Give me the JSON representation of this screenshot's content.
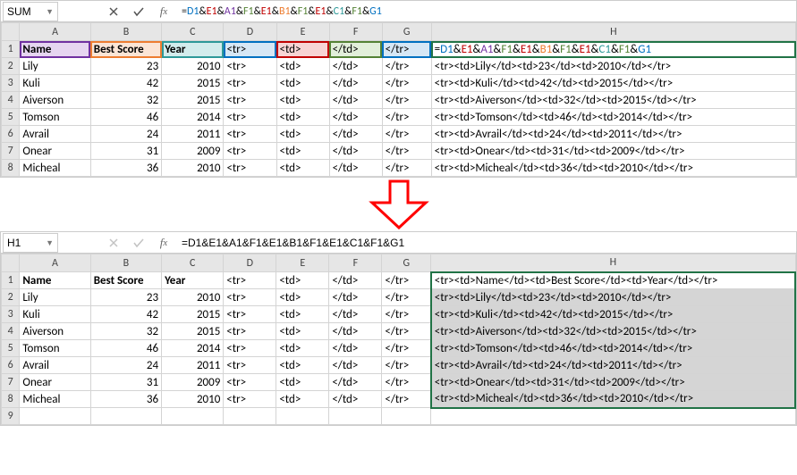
{
  "top": {
    "nameBox": "SUM",
    "formula_raw": "=D1&E1&A1&F1&E1&B1&F1&E1&C1&F1&G1",
    "formula_tokens": [
      {
        "t": "=",
        "cls": ""
      },
      {
        "t": "D1",
        "cls": "c-blue"
      },
      {
        "t": "&",
        "cls": ""
      },
      {
        "t": "E1",
        "cls": "c-red"
      },
      {
        "t": "&",
        "cls": ""
      },
      {
        "t": "A1",
        "cls": "c-purple"
      },
      {
        "t": "&",
        "cls": ""
      },
      {
        "t": "F1",
        "cls": "c-green2"
      },
      {
        "t": "&",
        "cls": ""
      },
      {
        "t": "E1",
        "cls": "c-red"
      },
      {
        "t": "&",
        "cls": ""
      },
      {
        "t": "B1",
        "cls": "c-orange"
      },
      {
        "t": "&",
        "cls": ""
      },
      {
        "t": "F1",
        "cls": "c-green2"
      },
      {
        "t": "&",
        "cls": ""
      },
      {
        "t": "E1",
        "cls": "c-red"
      },
      {
        "t": "&",
        "cls": ""
      },
      {
        "t": "C1",
        "cls": "c-teal"
      },
      {
        "t": "&",
        "cls": ""
      },
      {
        "t": "F1",
        "cls": "c-green2"
      },
      {
        "t": "&",
        "cls": ""
      },
      {
        "t": "G1",
        "cls": "c-blue"
      }
    ],
    "columns": [
      "A",
      "B",
      "C",
      "D",
      "E",
      "F",
      "G",
      "H"
    ],
    "rows": [
      {
        "n": "1",
        "A": "Name",
        "B": "Best Score",
        "C": "Year",
        "D": "<tr>",
        "E": "<td>",
        "F": "</td>",
        "G": "</tr>",
        "H": ""
      },
      {
        "n": "2",
        "A": "Lily",
        "B": "23",
        "C": "2010",
        "D": "<tr>",
        "E": "<td>",
        "F": "</td>",
        "G": "</tr>",
        "H": "<tr><td>Lily</td><td>23</td><td>2010</td></tr>"
      },
      {
        "n": "3",
        "A": "Kuli",
        "B": "42",
        "C": "2015",
        "D": "<tr>",
        "E": "<td>",
        "F": "</td>",
        "G": "</tr>",
        "H": "<tr><td>Kuli</td><td>42</td><td>2015</td></tr>"
      },
      {
        "n": "4",
        "A": "Aiverson",
        "B": "32",
        "C": "2015",
        "D": "<tr>",
        "E": "<td>",
        "F": "</td>",
        "G": "</tr>",
        "H": "<tr><td>Aiverson</td><td>32</td><td>2015</td></tr>"
      },
      {
        "n": "5",
        "A": "Tomson",
        "B": "46",
        "C": "2014",
        "D": "<tr>",
        "E": "<td>",
        "F": "</td>",
        "G": "</tr>",
        "H": "<tr><td>Tomson</td><td>46</td><td>2014</td></tr>"
      },
      {
        "n": "6",
        "A": "Avrail",
        "B": "24",
        "C": "2011",
        "D": "<tr>",
        "E": "<td>",
        "F": "</td>",
        "G": "</tr>",
        "H": "<tr><td>Avrail</td><td>24</td><td>2011</td></tr>"
      },
      {
        "n": "7",
        "A": "Onear",
        "B": "31",
        "C": "2009",
        "D": "<tr>",
        "E": "<td>",
        "F": "</td>",
        "G": "</tr>",
        "H": "<tr><td>Onear</td><td>31</td><td>2009</td></tr>"
      },
      {
        "n": "8",
        "A": "Micheal",
        "B": "36",
        "C": "2010",
        "D": "<tr>",
        "E": "<td>",
        "F": "</td>",
        "G": "</tr>",
        "H": "<tr><td>Micheal</td><td>36</td><td>2010</td></tr>"
      }
    ]
  },
  "bottom": {
    "nameBox": "H1",
    "formula_raw": "=D1&E1&A1&F1&E1&B1&F1&E1&C1&F1&G1",
    "columns": [
      "A",
      "B",
      "C",
      "D",
      "E",
      "F",
      "G",
      "H"
    ],
    "rows": [
      {
        "n": "1",
        "A": "Name",
        "B": "Best Score",
        "C": "Year",
        "D": "<tr>",
        "E": "<td>",
        "F": "</td>",
        "G": "</tr>",
        "H": "<tr><td>Name</td><td>Best Score</td><td>Year</td></tr>"
      },
      {
        "n": "2",
        "A": "Lily",
        "B": "23",
        "C": "2010",
        "D": "<tr>",
        "E": "<td>",
        "F": "</td>",
        "G": "</tr>",
        "H": "<tr><td>Lily</td><td>23</td><td>2010</td></tr>"
      },
      {
        "n": "3",
        "A": "Kuli",
        "B": "42",
        "C": "2015",
        "D": "<tr>",
        "E": "<td>",
        "F": "</td>",
        "G": "</tr>",
        "H": "<tr><td>Kuli</td><td>42</td><td>2015</td></tr>"
      },
      {
        "n": "4",
        "A": "Aiverson",
        "B": "32",
        "C": "2015",
        "D": "<tr>",
        "E": "<td>",
        "F": "</td>",
        "G": "</tr>",
        "H": "<tr><td>Aiverson</td><td>32</td><td>2015</td></tr>"
      },
      {
        "n": "5",
        "A": "Tomson",
        "B": "46",
        "C": "2014",
        "D": "<tr>",
        "E": "<td>",
        "F": "</td>",
        "G": "</tr>",
        "H": "<tr><td>Tomson</td><td>46</td><td>2014</td></tr>"
      },
      {
        "n": "6",
        "A": "Avrail",
        "B": "24",
        "C": "2011",
        "D": "<tr>",
        "E": "<td>",
        "F": "</td>",
        "G": "</tr>",
        "H": "<tr><td>Avrail</td><td>24</td><td>2011</td></tr>"
      },
      {
        "n": "7",
        "A": "Onear",
        "B": "31",
        "C": "2009",
        "D": "<tr>",
        "E": "<td>",
        "F": "</td>",
        "G": "</tr>",
        "H": "<tr><td>Onear</td><td>31</td><td>2009</td></tr>"
      },
      {
        "n": "8",
        "A": "Micheal",
        "B": "36",
        "C": "2010",
        "D": "<tr>",
        "E": "<td>",
        "F": "</td>",
        "G": "</tr>",
        "H": "<tr><td>Micheal</td><td>36</td><td>2010</td></tr>"
      },
      {
        "n": "9",
        "A": "",
        "B": "",
        "C": "",
        "D": "",
        "E": "",
        "F": "",
        "G": "",
        "H": ""
      }
    ]
  }
}
